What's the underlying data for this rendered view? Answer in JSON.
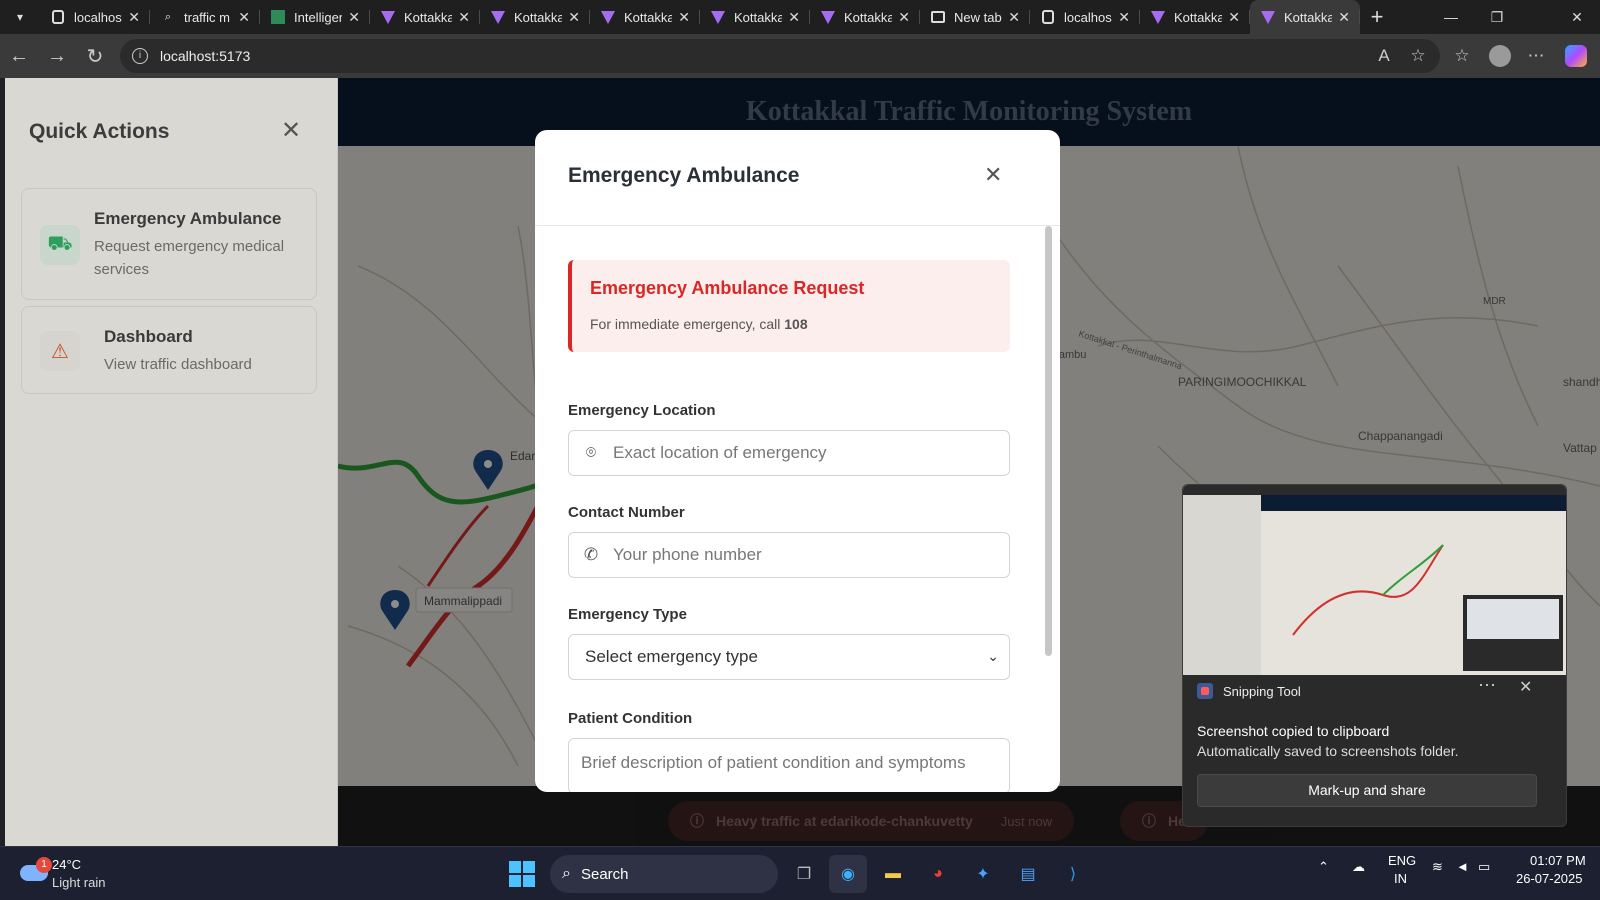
{
  "browser": {
    "tabs": [
      {
        "title": "localhost",
        "icon": "document-icon",
        "kind": "doc"
      },
      {
        "title": "traffic m",
        "icon": "search-icon",
        "kind": "search"
      },
      {
        "title": "Intelliger",
        "icon": "int-icon",
        "kind": "int"
      },
      {
        "title": "Kottakka",
        "icon": "vite-icon",
        "kind": "vite"
      },
      {
        "title": "Kottakka",
        "icon": "vite-icon",
        "kind": "vite"
      },
      {
        "title": "Kottakka",
        "icon": "vite-icon",
        "kind": "vite"
      },
      {
        "title": "Kottakka",
        "icon": "vite-icon",
        "kind": "vite"
      },
      {
        "title": "Kottakka",
        "icon": "vite-icon",
        "kind": "vite"
      },
      {
        "title": "New tab",
        "icon": "newtab-icon",
        "kind": "newtab"
      },
      {
        "title": "localhos",
        "icon": "document-icon",
        "kind": "doc"
      },
      {
        "title": "Kottakka",
        "icon": "vite-icon",
        "kind": "vite"
      },
      {
        "title": "Kottakka",
        "icon": "vite-icon",
        "kind": "vite",
        "active": true
      }
    ],
    "url": "localhost:5173"
  },
  "app": {
    "title": "Kottakkal Traffic Monitoring System"
  },
  "map_labels": [
    {
      "text": "PARINGIMOOCHIKKAL"
    },
    {
      "text": "Chappanangadi"
    },
    {
      "text": "Mammalippadi"
    },
    {
      "text": "Edarikod"
    },
    {
      "text": "MDR"
    },
    {
      "text": "shandhi"
    },
    {
      "text": "Vattap"
    },
    {
      "text": "parambu"
    },
    {
      "text": "Kottakkal - Perinthalmanna"
    }
  ],
  "alerts": [
    {
      "text": "Heavy traffic at edarikode-chankuvetty",
      "time": "Just now"
    },
    {
      "text": "He"
    }
  ],
  "quick_actions": {
    "title": "Quick Actions",
    "items": [
      {
        "title": "Emergency Ambulance",
        "desc": "Request emergency medical services",
        "icon": "ambulance-icon"
      },
      {
        "title": "Dashboard",
        "desc": "View traffic dashboard",
        "icon": "warning-icon"
      }
    ]
  },
  "modal": {
    "title": "Emergency Ambulance",
    "alert_title": "Emergency Ambulance Request",
    "alert_text": "For immediate emergency, call",
    "alert_number": "108",
    "location_label": "Emergency Location",
    "location_placeholder": "Exact location of emergency",
    "contact_label": "Contact Number",
    "contact_placeholder": "Your phone number",
    "type_label": "Emergency Type",
    "type_selected": "Select emergency type",
    "condition_label": "Patient Condition",
    "condition_placeholder": "Brief description of patient condition and symptoms"
  },
  "notification": {
    "app": "Snipping Tool",
    "heading": "Screenshot copied to clipboard",
    "body": "Automatically saved to screenshots folder.",
    "button": "Mark-up and share"
  },
  "taskbar": {
    "weather_temp": "24°C",
    "weather_desc": "Light rain",
    "weather_badge": "1",
    "search_label": "Search",
    "lang_top": "ENG",
    "lang_bottom": "IN",
    "time": "01:07 PM",
    "date": "26-07-2025"
  },
  "colors": {
    "accent_red": "#dc2626",
    "header_navy": "#0c1c33",
    "route_red": "#d32f2f",
    "route_green": "#2e9e3a",
    "marker_blue": "#1e4f8a"
  }
}
